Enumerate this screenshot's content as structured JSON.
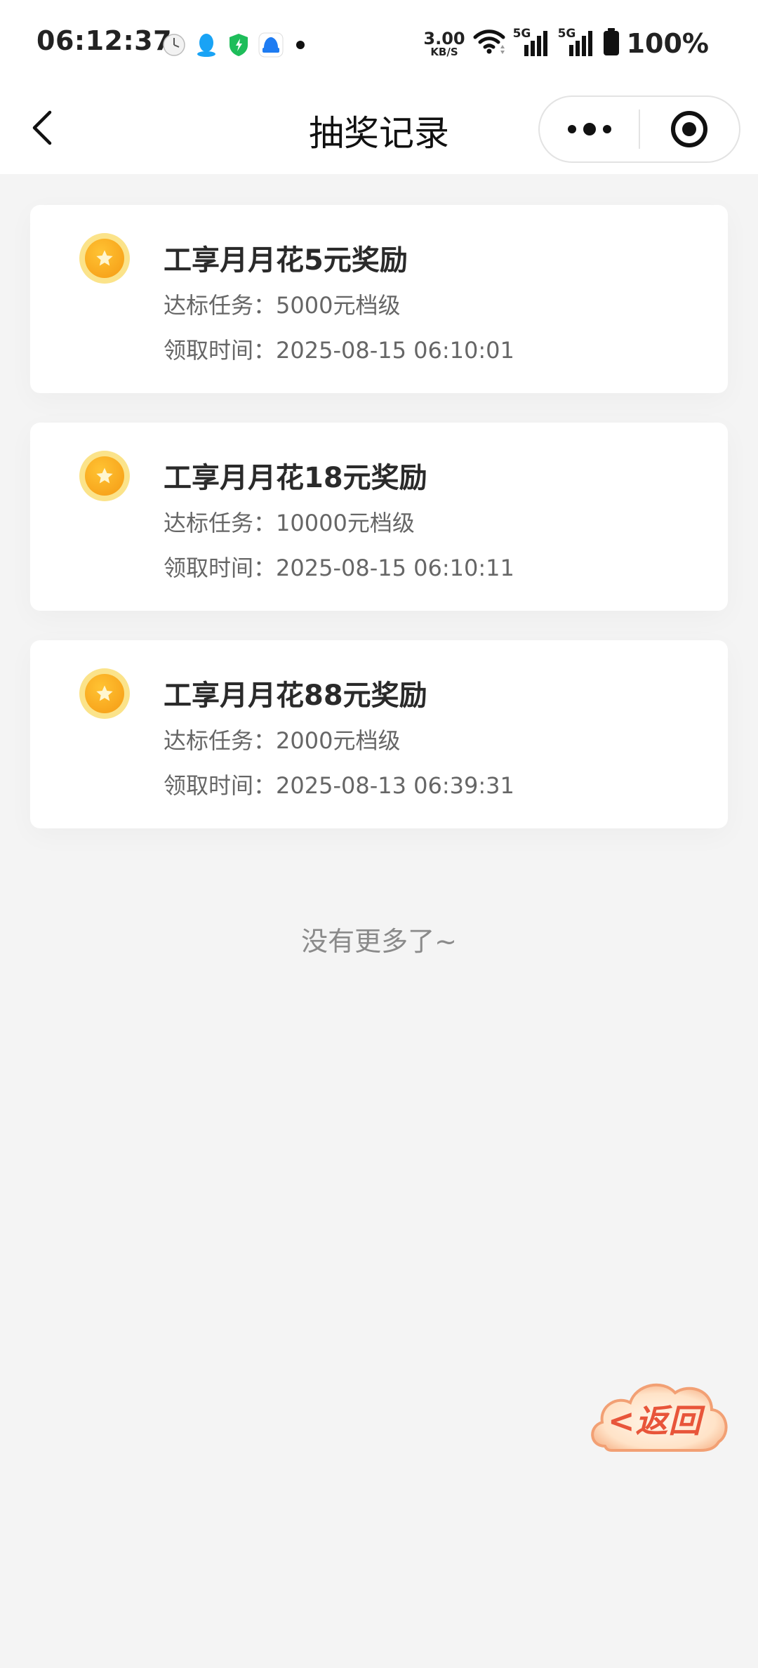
{
  "status_bar": {
    "time": "06:12:37",
    "left_icons": [
      "clock-app-icon",
      "qq-icon",
      "security-shield-icon",
      "app-notification-icon"
    ],
    "net_speed_value": "3.00",
    "net_speed_unit": "KB/S",
    "signal_1_label": "5G",
    "signal_2_label": "5G",
    "battery_text": "100%"
  },
  "nav": {
    "title": "抽奖记录"
  },
  "records": [
    {
      "title": "工享月月花5元奖励",
      "task_label": "达标任务：",
      "task_value": "5000元档级",
      "time_label": "领取时间：",
      "time_value": "2025-08-15 06:10:01"
    },
    {
      "title": "工享月月花18元奖励",
      "task_label": "达标任务：",
      "task_value": "10000元档级",
      "time_label": "领取时间：",
      "time_value": "2025-08-15 06:10:11"
    },
    {
      "title": "工享月月花88元奖励",
      "task_label": "达标任务：",
      "task_value": "2000元档级",
      "time_label": "领取时间：",
      "time_value": "2025-08-13 06:39:31"
    }
  ],
  "footer": {
    "no_more_text": "没有更多了~"
  },
  "floating": {
    "return_label": "<返回"
  },
  "colors": {
    "page_bg": "#f4f4f4",
    "card_bg": "#ffffff",
    "medal_gold": "#f59a14",
    "return_red": "#e8553a"
  }
}
